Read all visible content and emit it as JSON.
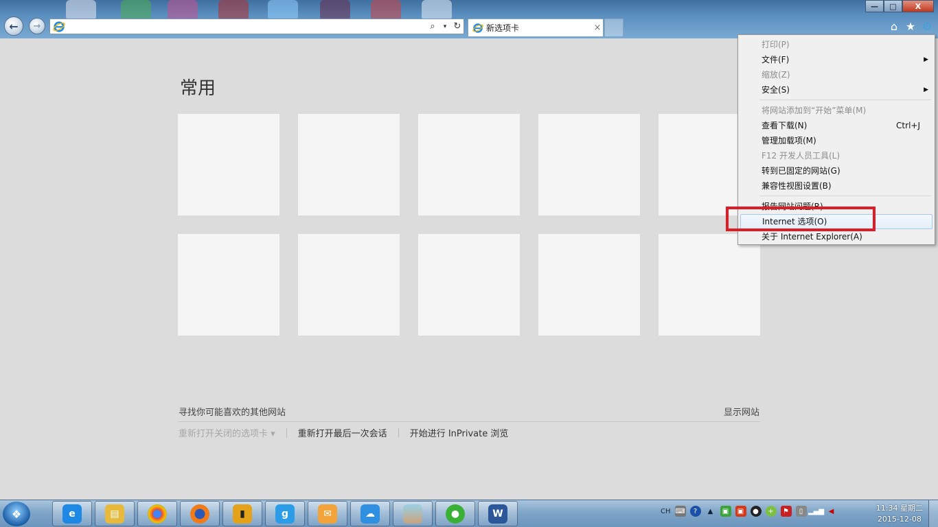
{
  "browser": {
    "tab_title": "新选项卡",
    "tab_close": "×",
    "address_value": "",
    "icons": {
      "back": "arrow-left-icon",
      "forward": "arrow-right-icon",
      "search": "search-icon",
      "refresh": "refresh-icon",
      "home": "home-icon",
      "favorites": "star-icon",
      "tools": "gear-icon"
    },
    "window": {
      "minimize": "—",
      "maximize": "□",
      "close": "X"
    }
  },
  "newtab": {
    "heading": "常用",
    "suggest_label": "寻找你可能喜欢的其他网站",
    "show_sites": "显示网站",
    "links": [
      "重新打开关闭的选项卡 ▾",
      "重新打开最后一次会话",
      "开始进行 InPrivate 浏览"
    ]
  },
  "menu": {
    "items": [
      {
        "label": "打印(P)"
      },
      {
        "label": "文件(F)",
        "arrow": "▶"
      },
      {
        "label": "缩放(Z)"
      },
      {
        "label": "安全(S)",
        "arrow": "▶"
      },
      {
        "label": "将网站添加到“开始”菜单(M)"
      },
      {
        "label": "查看下载(N)",
        "shortcut": "Ctrl+J"
      },
      {
        "label": "管理加载项(M)"
      },
      {
        "label": "F12 开发人员工具(L)"
      },
      {
        "label": "转到已固定的网站(G)"
      },
      {
        "label": "兼容性视图设置(B)"
      },
      {
        "label": "报告网站问题(R)"
      },
      {
        "label": "Internet 选项(O)"
      },
      {
        "label": "关于 Internet Explorer(A)"
      }
    ]
  },
  "taskbar": {
    "apps": [
      "ie-icon",
      "file-explorer-icon",
      "chrome-icon",
      "firefox-icon",
      "book-app-icon",
      "word-game-icon",
      "outlook-icon",
      "cloud-app-icon",
      "photo-app-icon",
      "wechat-icon",
      "word-icon"
    ],
    "language": "CH",
    "time": "11:34 星期二",
    "date": "2015-12-08"
  },
  "colors": {
    "highlight_box": "#e01b24",
    "tile": "#f5f5f5",
    "background": "#dcdcdc"
  }
}
